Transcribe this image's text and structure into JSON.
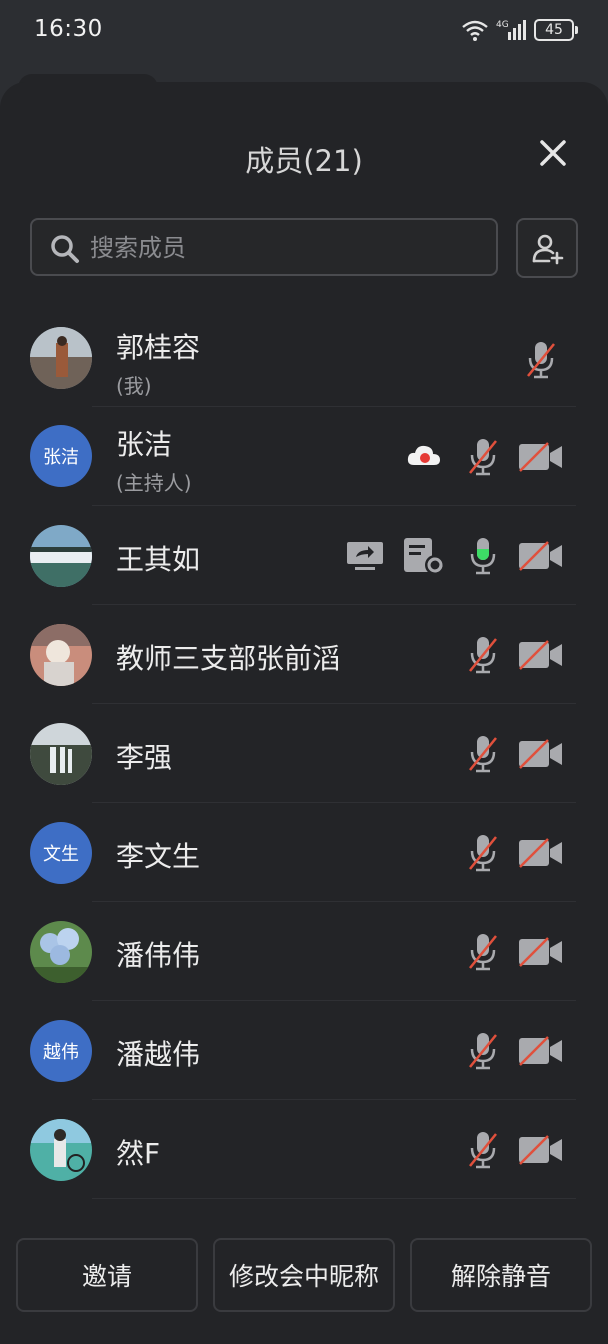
{
  "status_bar": {
    "time": "16:30",
    "network": "4G",
    "battery": "45"
  },
  "header": {
    "title": "成员(21)"
  },
  "search": {
    "placeholder": "搜索成员"
  },
  "members": [
    {
      "name": "郭桂容",
      "role": "(我)",
      "avatar": "photo-woman"
    },
    {
      "name": "张洁",
      "role": "(主持人)",
      "avatar_text": "张洁"
    },
    {
      "name": "王其如",
      "role": "",
      "avatar": "photo-waterfall"
    },
    {
      "name": "教师三支部张前滔",
      "role": "",
      "avatar": "photo-child"
    },
    {
      "name": "李强",
      "role": "",
      "avatar": "photo-falls"
    },
    {
      "name": "李文生",
      "role": "",
      "avatar_text": "文生"
    },
    {
      "name": "潘伟伟",
      "role": "",
      "avatar": "photo-flowers"
    },
    {
      "name": "潘越伟",
      "role": "",
      "avatar_text": "越伟"
    },
    {
      "name": "然F",
      "role": "",
      "avatar": "photo-kid"
    }
  ],
  "footer": {
    "invite_label": "邀请",
    "rename_label": "修改会中昵称",
    "unmute_label": "解除静音"
  },
  "colors": {
    "accent": "#3e6ec5",
    "mute_slash": "#e0503c",
    "mic_active": "#3ddc66",
    "record_dot": "#e53935"
  }
}
